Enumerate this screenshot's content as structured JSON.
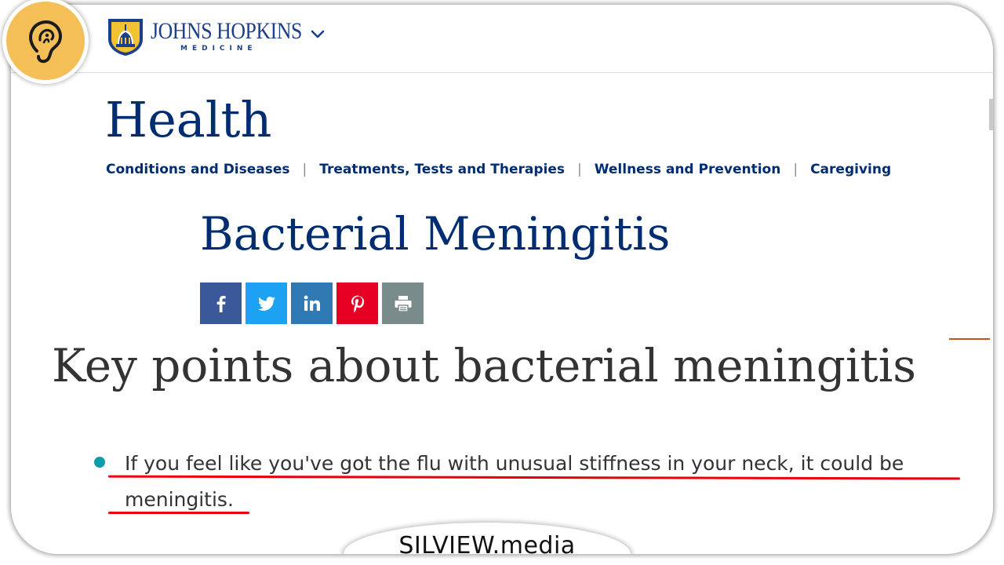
{
  "header": {
    "logo_name": "JOHNS HOPKINS",
    "logo_sub": "MEDICINE"
  },
  "section_title": "Health",
  "nav": {
    "items": [
      "Conditions and Diseases",
      "Treatments, Tests and Therapies",
      "Wellness and Prevention",
      "Caregiving"
    ],
    "separator": "|"
  },
  "article": {
    "title": "Bacterial Meningitis",
    "share_icons": [
      "facebook-icon",
      "twitter-icon",
      "linkedin-icon",
      "pinterest-icon",
      "print-icon"
    ],
    "share_colors": [
      "#3b5998",
      "#1da1f2",
      "#2f79b5",
      "#e60023",
      "#7a8b8c"
    ],
    "heading": "Key points about bacterial meningitis",
    "bullets": [
      "If you feel like you've got the flu with unusual stiffness in your neck, it could be meningitis."
    ]
  },
  "overlay": {
    "watermark": "SILVIEW.media",
    "badge_icon": "ear-icon"
  },
  "colors": {
    "brand_navy": "#002d72",
    "bullet_teal": "#0f9ba8",
    "underline_red": "#e8000b",
    "badge_yellow": "#f5bf58"
  }
}
